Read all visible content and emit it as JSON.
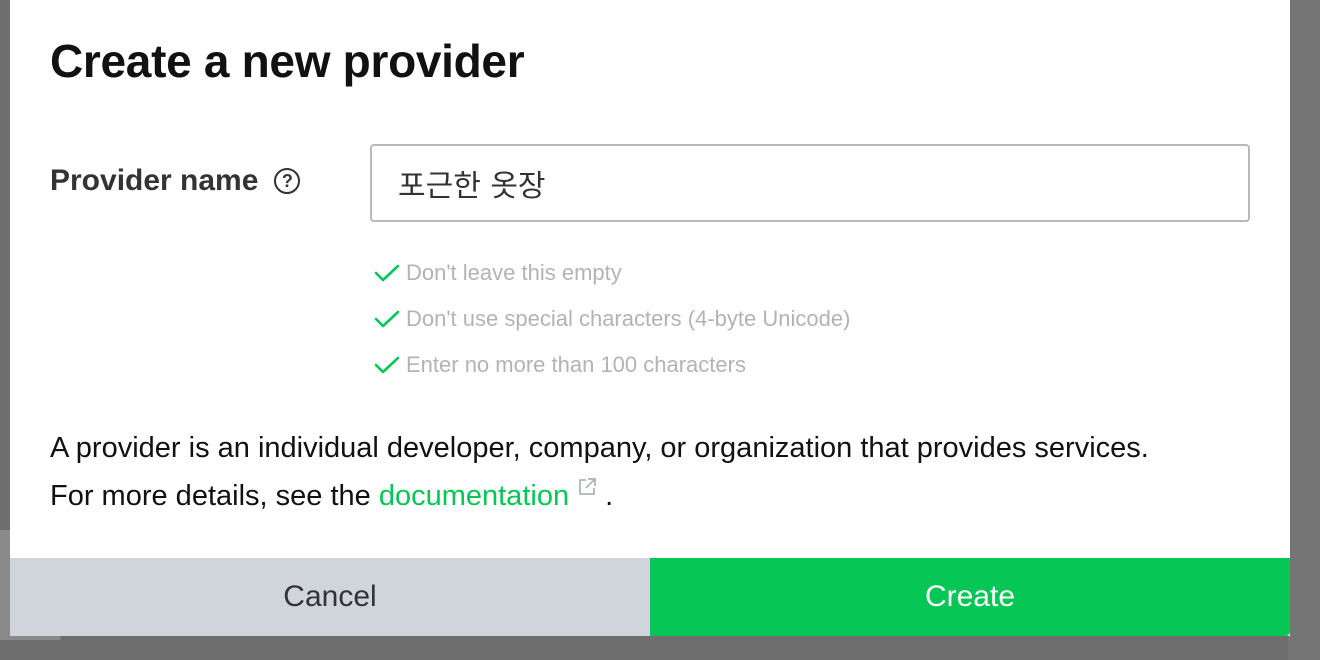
{
  "dialog": {
    "title": "Create a new provider",
    "field_label": "Provider name",
    "help_icon_glyph": "?",
    "input_value": "포근한 옷장",
    "rules": [
      {
        "icon": "check-icon",
        "text": "Don't leave this empty"
      },
      {
        "icon": "check-icon",
        "text": "Don't use special characters (4-byte Unicode)"
      },
      {
        "icon": "check-icon",
        "text": "Enter no more than 100 characters"
      }
    ],
    "description_prefix": "A provider is an individual developer, company, or organization that provides services. For more details, see the",
    "link_text": "documentation",
    "description_suffix": ".",
    "cancel_label": "Cancel",
    "create_label": "Create"
  },
  "colors": {
    "accent": "#06c755",
    "cancel_bg": "#d0d4db",
    "rule_text": "#b0b4ba"
  }
}
